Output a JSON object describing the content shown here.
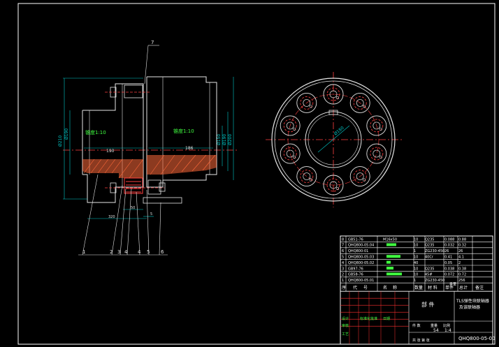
{
  "colors": {
    "background": "#000000",
    "frame": "#ffffff",
    "outline": "#e6e6e6",
    "dimension": "#00c8c8",
    "centerline": "#ff4040",
    "hatch": "#ff6a3a",
    "text_green": "#40ff40",
    "table_red": "#ff3030",
    "text_white": "#ffffff"
  },
  "drawing": {
    "balloon_7": "7",
    "taper_left": "锥度1:10",
    "taper_right": "锥度1:10",
    "dim_left_len": "190",
    "dim_right_len": "186",
    "dim_bottom_a": "320",
    "dim_bottom_b": "50",
    "dim_bottom_c": "5",
    "dim_v_left": "Ø210",
    "dim_v_left2": "Ø190",
    "dim_v_right1": "Ø150",
    "dim_v_right2": "Ø190",
    "dim_v_right3": "Ø200",
    "dim_diag": "Ø180",
    "balloons_bottom": [
      "1",
      "2",
      "3",
      "4",
      "4",
      "5",
      "6"
    ],
    "small_labels": [
      "80",
      "26"
    ]
  },
  "bom": {
    "rows": [
      {
        "no": "8",
        "code": "GB51-76",
        "name": "M16x50",
        "qty": "10",
        "mat": "Q235",
        "w1": "0.088",
        "w2": "0.88"
      },
      {
        "no": "7",
        "code": "QHQ800-05.04",
        "name": "",
        "qty": "10",
        "mat": "Q235",
        "w1": "0.032",
        "w2": "0.32"
      },
      {
        "no": "6",
        "code": "QHQ800-01",
        "name": "",
        "qty": "1",
        "mat": "ZG230-450",
        "w1": "26",
        "w2": "26"
      },
      {
        "no": "5",
        "code": "QHQ800-05.03",
        "name": "",
        "qty": "10",
        "mat": "40Cr",
        "w1": "0.41",
        "w2": "4.1"
      },
      {
        "no": "4",
        "code": "QHQ800-05.02",
        "name": "",
        "qty": "40",
        "mat": "",
        "w1": "0.05",
        "w2": "2"
      },
      {
        "no": "3",
        "code": "GB97-76",
        "name": "",
        "qty": "10",
        "mat": "Q235",
        "w1": "0.038",
        "w2": "0.38"
      },
      {
        "no": "2",
        "code": "GB58-76",
        "name": "",
        "qty": "10",
        "mat": "45#",
        "w1": "0.072",
        "w2": "0.72"
      },
      {
        "no": "1",
        "code": "QHQ800-05.01",
        "name": "",
        "qty": "1",
        "mat": "ZG230-450",
        "w1": "",
        "w2": "256"
      }
    ],
    "header": [
      "序",
      "代",
      "号",
      "名",
      "称",
      "数量",
      "材 料",
      "单件",
      "总计",
      "备注"
    ],
    "header_sub": "重量",
    "title_block": {
      "part": "部 件",
      "name_line1": "TLS弹性块联轴器",
      "name_line2": "及该联轴器",
      "scale_label": "比例",
      "weight_label": "重量",
      "sheet_qty": "件 数",
      "weight_value": "54",
      "scale_value": "1:4",
      "sheets": "共 张 第 张",
      "code": "QHQ800-05-00",
      "design": "设计",
      "check": "审核",
      "process": "工艺",
      "standard": "标准化",
      "approve": "批准",
      "date": "日期"
    }
  }
}
